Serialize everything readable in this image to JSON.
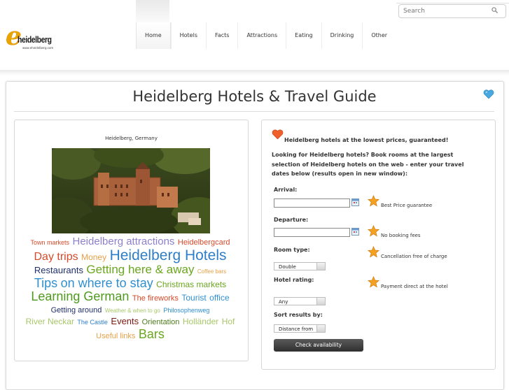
{
  "header": {
    "logo_text": "heidelberg",
    "logo_sub": "www.eheidelberg.com",
    "nav": [
      "Home",
      "Hotels",
      "Facts",
      "Attractions",
      "Eating",
      "Drinking",
      "Other"
    ],
    "search_placeholder": "Search"
  },
  "page": {
    "title": "Heidelberg Hotels & Travel Guide"
  },
  "left": {
    "caption": "Heidelberg, Germany",
    "tag_cloud": [
      {
        "text": "Town markets",
        "color": "#d64a2a",
        "size": 9
      },
      {
        "text": "Heidelberg attractions",
        "color": "#8e7fd0",
        "size": 15
      },
      {
        "text": "Heidelbergcard",
        "color": "#d64a2a",
        "size": 11
      },
      {
        "text": "Day trips",
        "color": "#d64a2a",
        "size": 16
      },
      {
        "text": "Money",
        "color": "#e8a048",
        "size": 12
      },
      {
        "text": "Heidelberg Hotels",
        "color": "#2f7fc8",
        "size": 21
      },
      {
        "text": "Restaurants",
        "color": "#1f2f6a",
        "size": 13
      },
      {
        "text": "Getting here & away",
        "color": "#6aa61e",
        "size": 17
      },
      {
        "text": "Coffee bars",
        "color": "#e8a048",
        "size": 8
      },
      {
        "text": "Tips",
        "color": "#2f8fd0",
        "size": 18
      },
      {
        "text": "on where to stay",
        "color": "#2f8fd0",
        "size": 18
      },
      {
        "text": "Christmas markets",
        "color": "#6aa61e",
        "size": 12
      },
      {
        "text": "Learning German",
        "color": "#4e9a1e",
        "size": 18
      },
      {
        "text": "The fireworks",
        "color": "#d64a2a",
        "size": 11
      },
      {
        "text": "Tourist",
        "color": "#2f8fd0",
        "size": 12
      },
      {
        "text": "office",
        "color": "#2f8fd0",
        "size": 12
      },
      {
        "text": "Getting around",
        "color": "#1f2f6a",
        "size": 11
      },
      {
        "text": "Weather & when to go",
        "color": "#a8c86a",
        "size": 8
      },
      {
        "text": "Philosophenweg",
        "color": "#2f8fd0",
        "size": 9
      },
      {
        "text": "River Neckar",
        "color": "#a8c86a",
        "size": 12
      },
      {
        "text": "The Castle",
        "color": "#2f7fc8",
        "size": 9
      },
      {
        "text": "Events",
        "color": "#7a1a10",
        "size": 13
      },
      {
        "text": "Orientation",
        "color": "#4e7a1e",
        "size": 11
      },
      {
        "text": "Holländer",
        "color": "#a8c86a",
        "size": 12
      },
      {
        "text": "Hof",
        "color": "#a8c86a",
        "size": 12
      },
      {
        "text": "Useful links",
        "color": "#e8a048",
        "size": 11
      },
      {
        "text": "Bars",
        "color": "#6aa61e",
        "size": 18
      }
    ]
  },
  "right": {
    "promo": "Heidelberg hotels at the lowest prices, guaranteed!",
    "intro": "Looking for Heidelberg hotels? Book rooms at the largest selection of Heidelberg hotels on the web - enter your travel dates below (results open in new window):",
    "arrival_label": "Arrival:",
    "departure_label": "Departure:",
    "room_type_label": "Room type:",
    "room_type_value": "Double",
    "hotel_rating_label": "Hotel rating:",
    "hotel_rating_value": "Any",
    "sort_label": "Sort results by:",
    "sort_value": "Distance from",
    "features": [
      "Best Price guarantee",
      "No booking fees",
      "Cancellation free of charge",
      "Payment direct at the hotel"
    ],
    "button": "Check availability"
  }
}
